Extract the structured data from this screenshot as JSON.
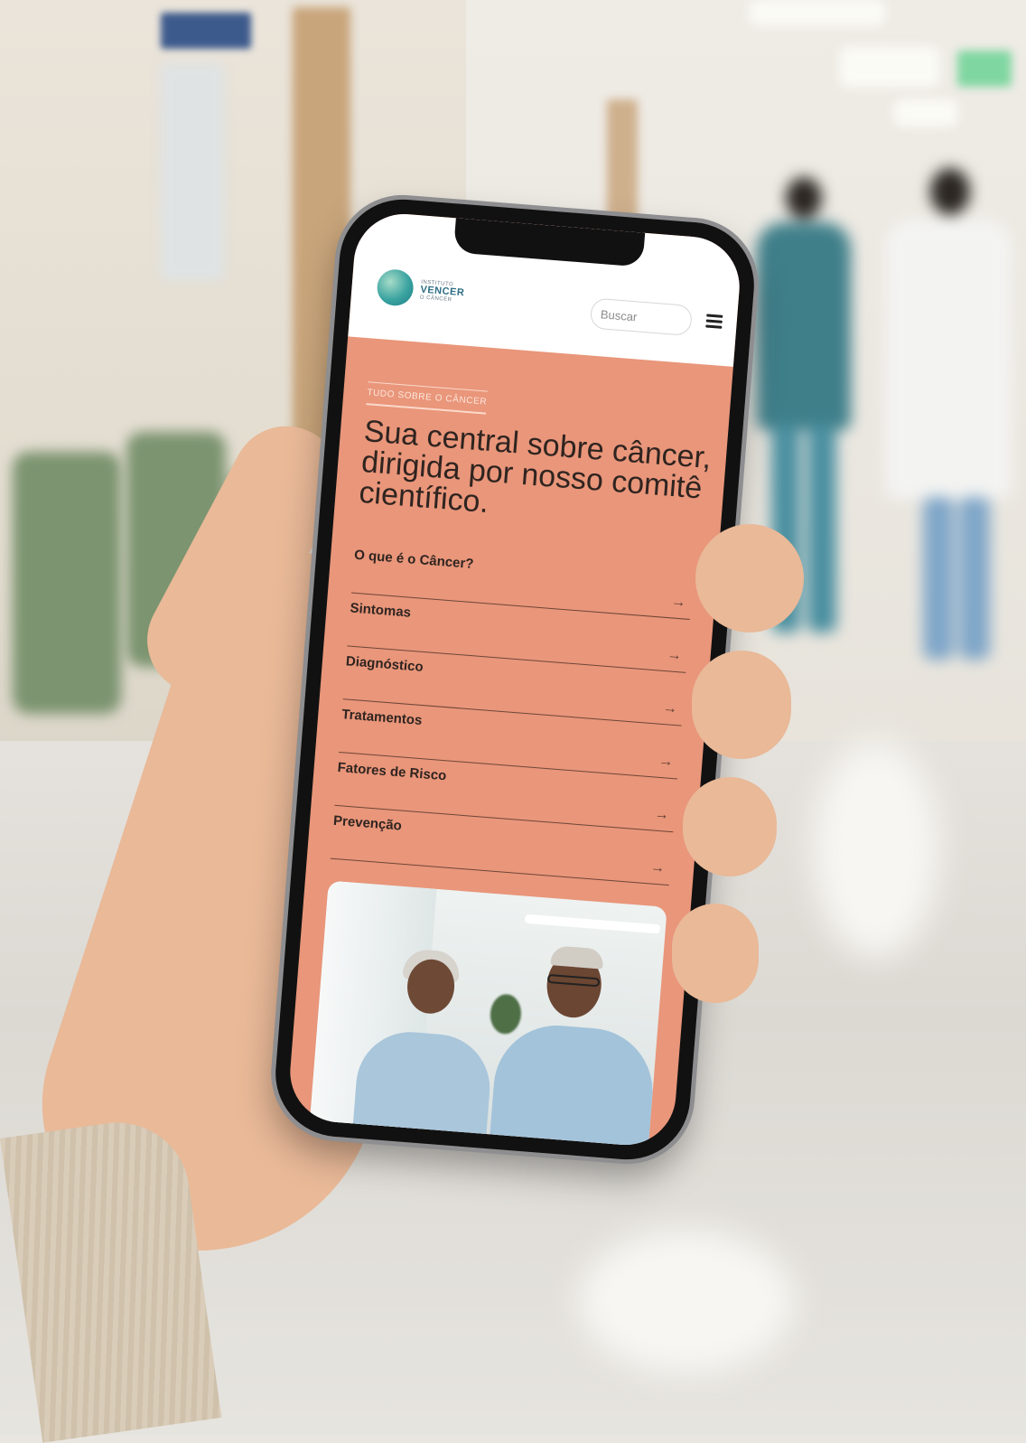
{
  "site": {
    "logo": {
      "line1": "INSTITUTO",
      "line2": "VENCER",
      "line3": "O CÂNCER"
    },
    "search": {
      "placeholder": "Buscar"
    },
    "menu_icon": "hamburger-menu-icon"
  },
  "hero": {
    "eyebrow": "TUDO SOBRE O CÂNCER",
    "headline": "Sua central sobre câncer, dirigida por nosso comitê científico."
  },
  "nav": {
    "items": [
      {
        "label": "O que é o Câncer?",
        "arrow": "→"
      },
      {
        "label": "Sintomas",
        "arrow": "→"
      },
      {
        "label": "Diagnóstico",
        "arrow": "→"
      },
      {
        "label": "Tratamentos",
        "arrow": "→"
      },
      {
        "label": "Fatores de Risco",
        "arrow": "→"
      },
      {
        "label": "Prevenção",
        "arrow": "→"
      }
    ]
  },
  "colors": {
    "accent": "#e9967a",
    "header_bg": "#ffffff",
    "text_dark": "#2f2420",
    "logo_teal": "#2c6e84"
  }
}
